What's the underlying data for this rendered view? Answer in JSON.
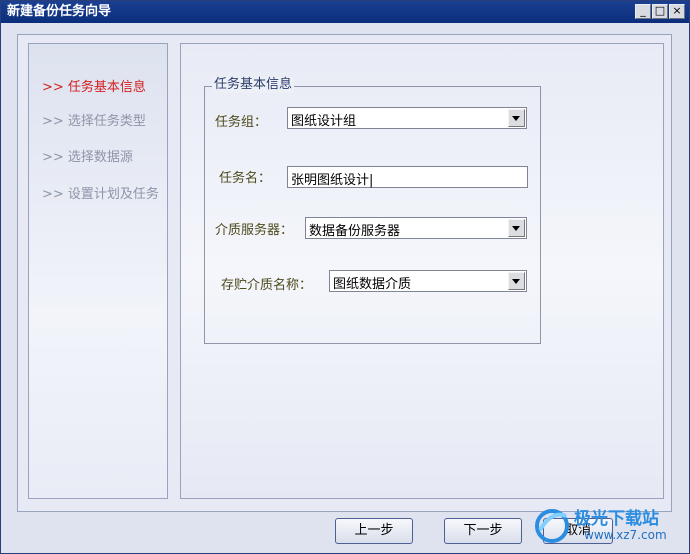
{
  "window": {
    "title": "新建备份任务向导",
    "controls": {
      "minimize": "_",
      "maximize": "□",
      "close": "×"
    }
  },
  "steps": [
    {
      "label": ">> 任务基本信息",
      "active": true
    },
    {
      "label": ">> 选择任务类型",
      "active": false
    },
    {
      "label": ">> 选择数据源",
      "active": false
    },
    {
      "label": ">> 设置计划及任务",
      "active": false
    }
  ],
  "form": {
    "group_title": "任务基本信息",
    "task_group": {
      "label": "任务组：",
      "value": "图纸设计组"
    },
    "task_name": {
      "label": "任务名：",
      "value": "张明图纸设计|"
    },
    "media_server": {
      "label": "介质服务器：",
      "value": "数据备份服务器"
    },
    "media_name": {
      "label": "存贮介质名称：",
      "value": "图纸数据介质"
    }
  },
  "buttons": {
    "prev": "上一步",
    "next": "下一步",
    "cancel": "取消"
  },
  "watermark": {
    "text": "极光下载站",
    "url": "www.xz7.com"
  },
  "colors": {
    "titlebar": "#0b2e7c",
    "active_step": "#d42020",
    "inactive_step": "#8e95a9",
    "accent": "#2a8de0"
  }
}
